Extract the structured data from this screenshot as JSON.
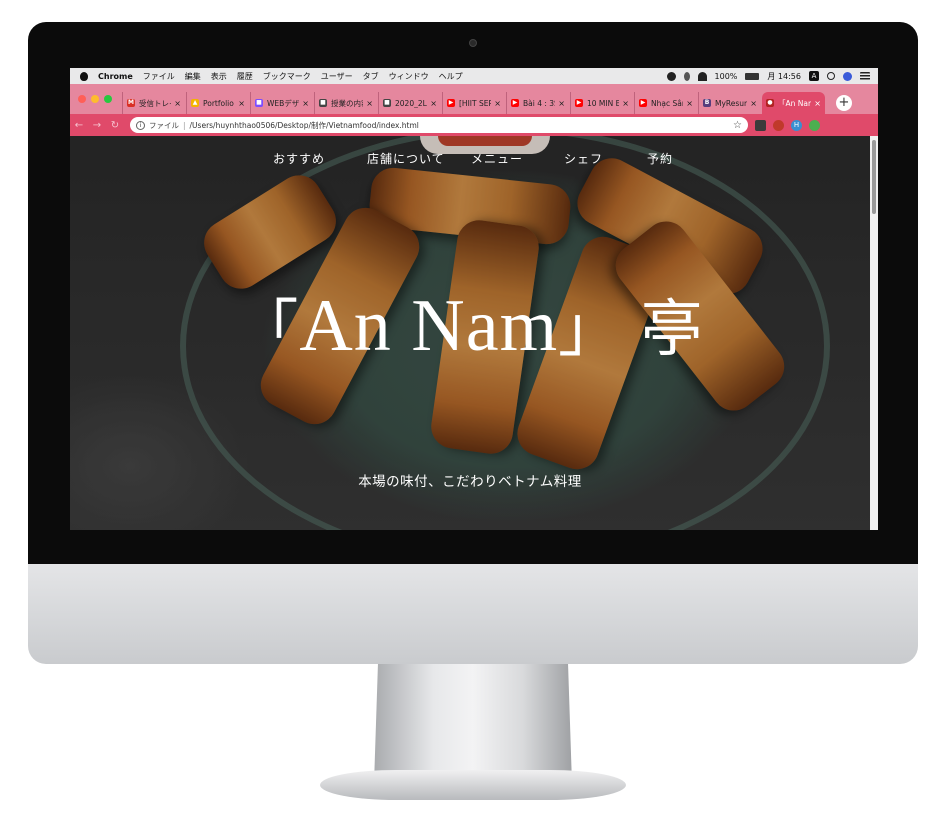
{
  "menubar": {
    "app_name": "Chrome",
    "menus": [
      "ファイル",
      "編集",
      "表示",
      "履歴",
      "ブックマーク",
      "ユーザー",
      "タブ",
      "ウィンドウ",
      "ヘルプ"
    ],
    "battery": "100%",
    "clock": "月 14:56",
    "input_mode": "A"
  },
  "tabs": [
    {
      "title": "受信トレイ",
      "favicon_color": "#d93025",
      "favicon_glyph": "M"
    },
    {
      "title": "Portfolio",
      "favicon_color": "#f4b400",
      "favicon_glyph": "▲"
    },
    {
      "title": "WEBデザ",
      "favicon_color": "#7c4dff",
      "favicon_glyph": "■"
    },
    {
      "title": "授業の内容",
      "favicon_color": "#444444",
      "favicon_glyph": "■"
    },
    {
      "title": "2020_2L",
      "favicon_color": "#444444",
      "favicon_glyph": "■"
    },
    {
      "title": "[HIIT SER",
      "favicon_color": "#ff0000",
      "favicon_glyph": "▶"
    },
    {
      "title": "Bài 4 : 3S",
      "favicon_color": "#ff0000",
      "favicon_glyph": "▶"
    },
    {
      "title": "10 MIN E",
      "favicon_color": "#ff0000",
      "favicon_glyph": "▶"
    },
    {
      "title": "Nhạc Sân",
      "favicon_color": "#ff0000",
      "favicon_glyph": "▶"
    },
    {
      "title": "MyResum",
      "favicon_color": "#563d7c",
      "favicon_glyph": "B"
    },
    {
      "title": "「An Nam",
      "favicon_color": "#b22222",
      "favicon_glyph": "●",
      "active": true
    }
  ],
  "address_bar": {
    "scheme_label": "ファイル",
    "url": "/Users/huynhthao0506/Desktop/制作/Vietnamfood/index.html"
  },
  "profile_initial": "H",
  "page": {
    "nav": [
      "おすすめ",
      "店舗について",
      "メニュー",
      "シェフ",
      "予約"
    ],
    "title_open": "「",
    "title_main": "An Nam",
    "title_close": "」",
    "title_kanji": "亭",
    "subtitle": "本場の味付、こだわりベトナム料理"
  },
  "colors": {
    "tab_strip": "#e5879e",
    "toolbar": "#e04a6a",
    "traffic_red": "#ff5f57",
    "traffic_yellow": "#febc2e",
    "traffic_green": "#28c840"
  }
}
